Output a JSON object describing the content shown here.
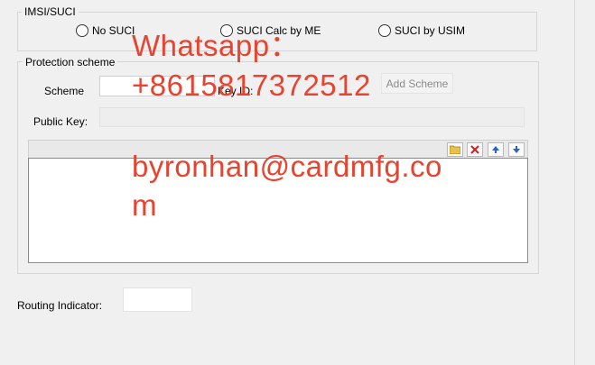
{
  "imsi_group": {
    "title": "IMSI/SUCI",
    "options": [
      {
        "label": "No SUCI"
      },
      {
        "label": "SUCI Calc by ME"
      },
      {
        "label": "SUCI by USIM"
      }
    ]
  },
  "protection_group": {
    "title": "Protection scheme",
    "scheme_label": "Scheme",
    "key_id_label": "Key ID:",
    "scheme_value": "",
    "add_scheme_label": "Add Scheme",
    "public_key_label": "Public Key:",
    "public_key_value": ""
  },
  "list_toolbar": {
    "icons": [
      "folder-icon",
      "delete-icon",
      "arrow-up-icon",
      "arrow-down-icon"
    ]
  },
  "routing": {
    "label": "Routing Indicator:",
    "value": ""
  },
  "watermark": {
    "line1": "Whatsapp：",
    "line2": "+8615817372512",
    "line3": "byronhan@cardmfg.co",
    "line4": "m"
  },
  "colors": {
    "watermark": "#e8432f",
    "background": "#f0f0f0"
  }
}
